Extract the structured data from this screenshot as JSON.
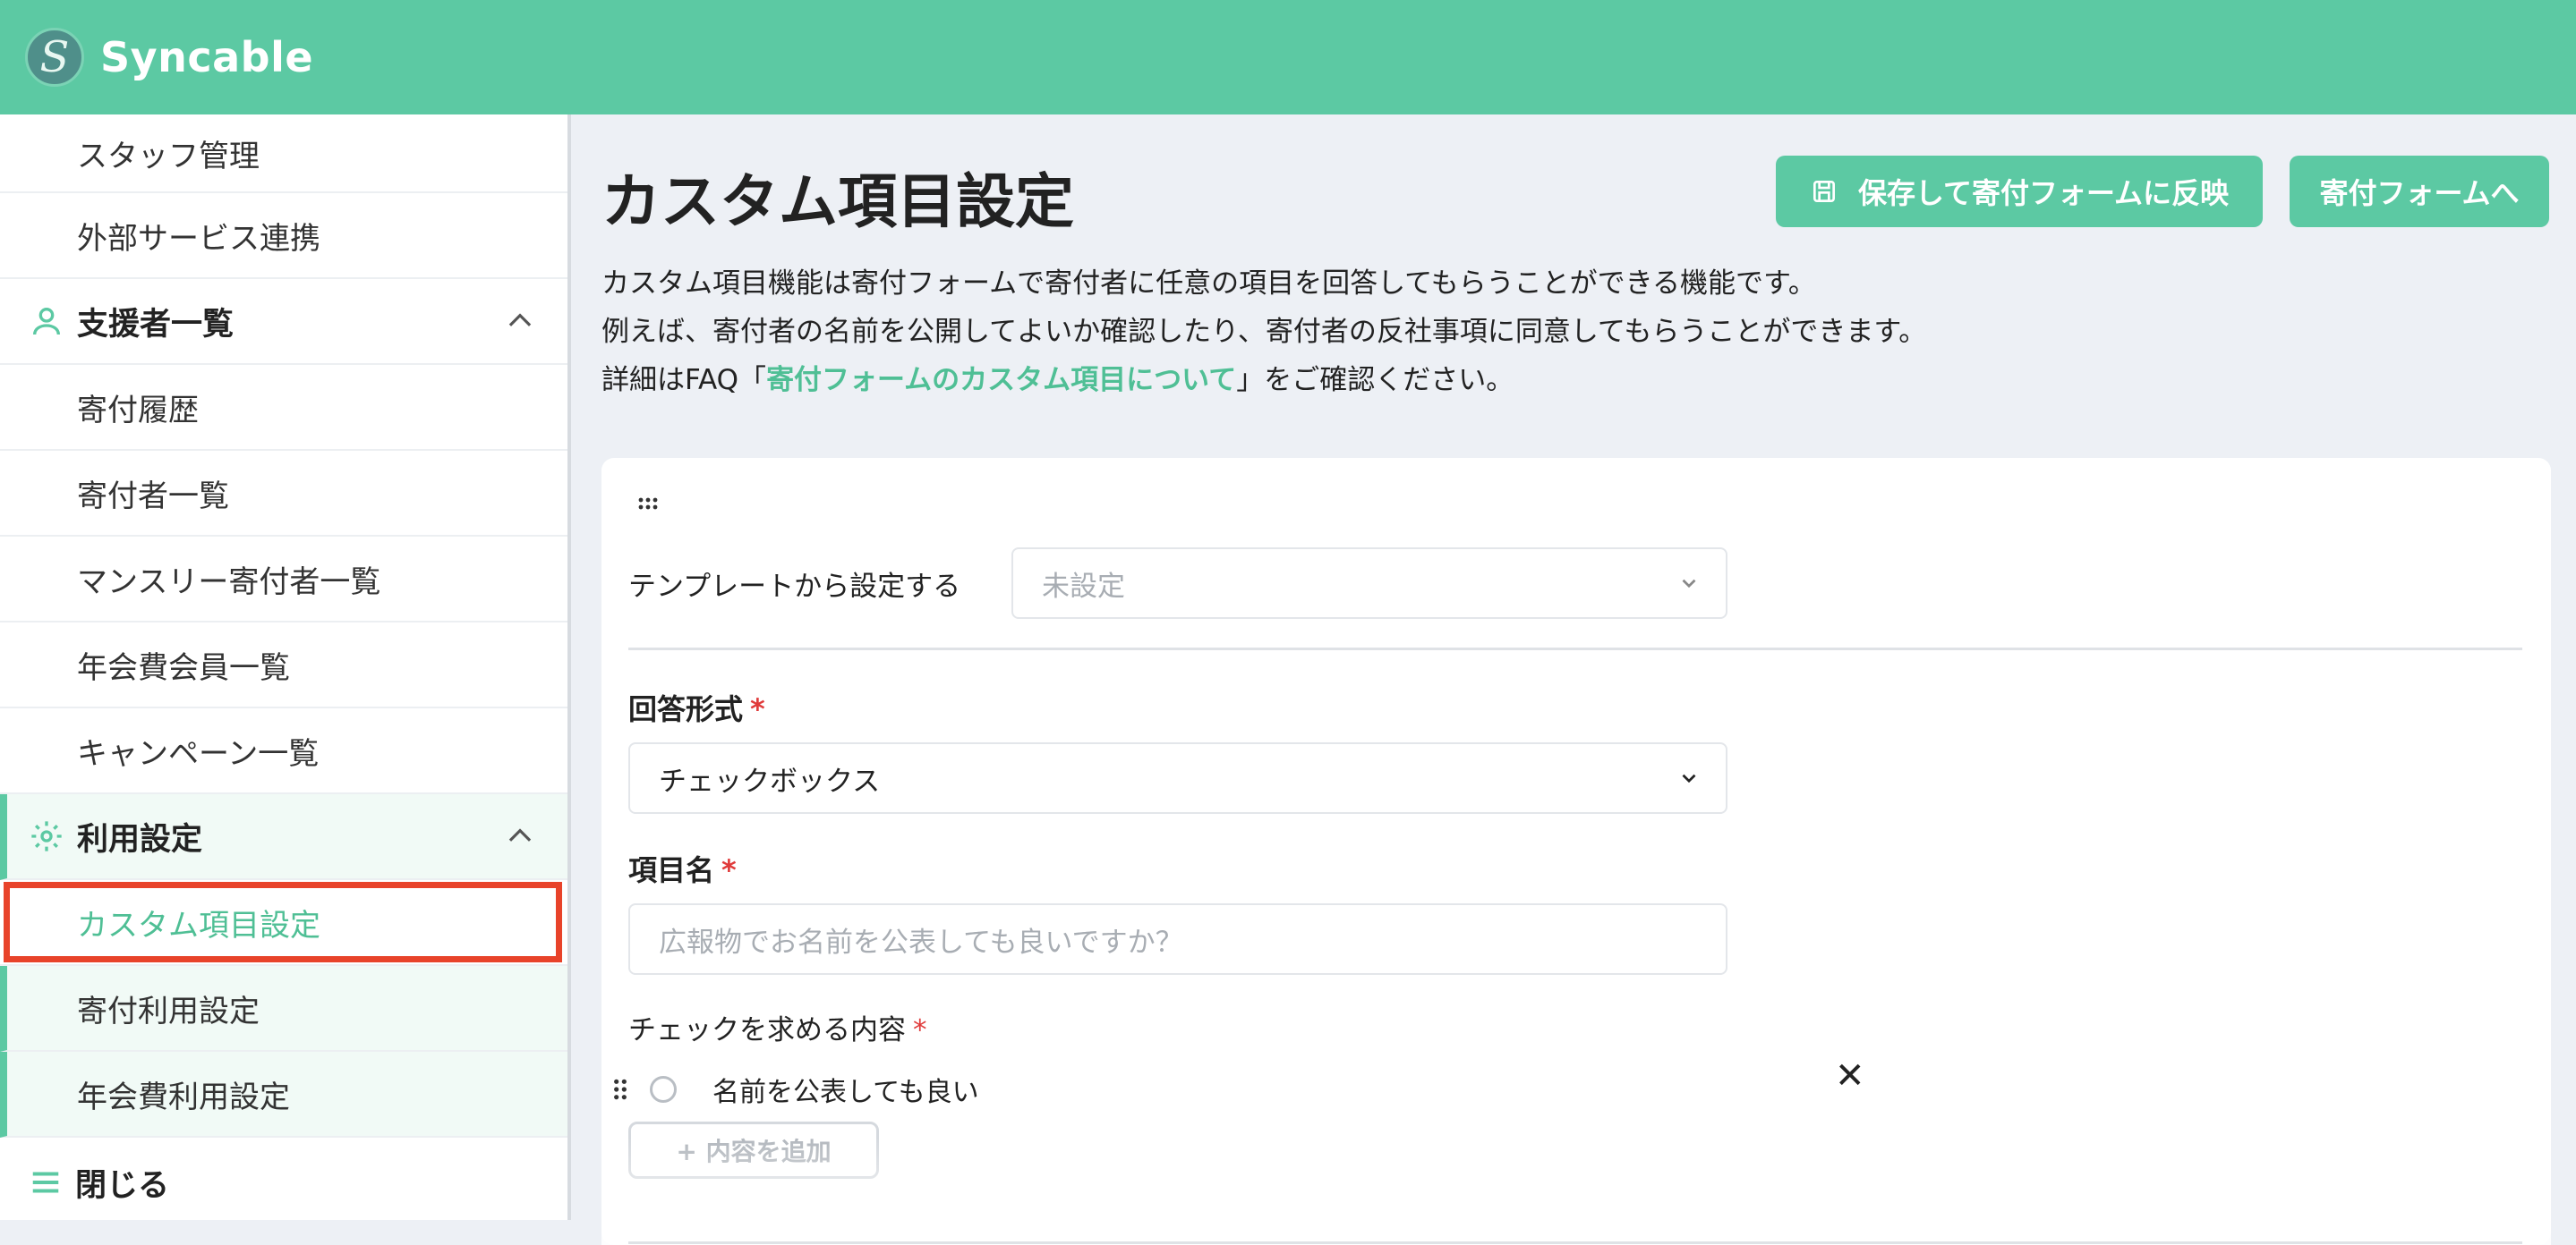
{
  "app": {
    "name": "Syncable",
    "logo_letter": "S"
  },
  "sidebar": {
    "items_top": [
      {
        "label": "スタッフ管理"
      },
      {
        "label": "外部サービス連携"
      }
    ],
    "group_supporters": {
      "label": "支援者一覧",
      "icon": "person-icon",
      "items": [
        {
          "label": "寄付履歴"
        },
        {
          "label": "寄付者一覧"
        },
        {
          "label": "マンスリー寄付者一覧"
        },
        {
          "label": "年会費会員一覧"
        },
        {
          "label": "キャンペーン一覧"
        }
      ]
    },
    "group_settings": {
      "label": "利用設定",
      "icon": "gear-icon",
      "items": [
        {
          "label": "カスタム項目設定",
          "selected": true
        },
        {
          "label": "寄付利用設定"
        },
        {
          "label": "年会費利用設定"
        }
      ]
    },
    "close_label": "閉じる"
  },
  "main": {
    "title": "カスタム項目設定",
    "save_button": "保存して寄付フォームに反映",
    "form_button": "寄付フォームへ",
    "description": {
      "line1": "カスタム項目機能は寄付フォームで寄付者に任意の項目を回答してもらうことができる機能です。",
      "line2": "例えば、寄付者の名前を公開してよいか確認したり、寄付者の反社事項に同意してもらうことができます。",
      "line3_prefix": "詳細はFAQ「",
      "line3_link": "寄付フォームのカスタム項目について",
      "line3_suffix": "」をご確認ください。"
    },
    "form": {
      "template_label": "テンプレートから設定する",
      "template_value": "未設定",
      "answer_type_label": "回答形式",
      "answer_type_value": "チェックボックス",
      "item_name_label": "項目名",
      "item_name_placeholder": "広報物でお名前を公表しても良いですか？",
      "check_content_label": "チェックを求める内容",
      "options": [
        {
          "label": "名前を公表しても良い"
        }
      ],
      "add_content_button": "+ 内容を追加",
      "required_mark": "*"
    }
  },
  "colors": {
    "brand": "#5cc9a3",
    "highlight": "#e8432a",
    "required": "#e03b3b"
  }
}
